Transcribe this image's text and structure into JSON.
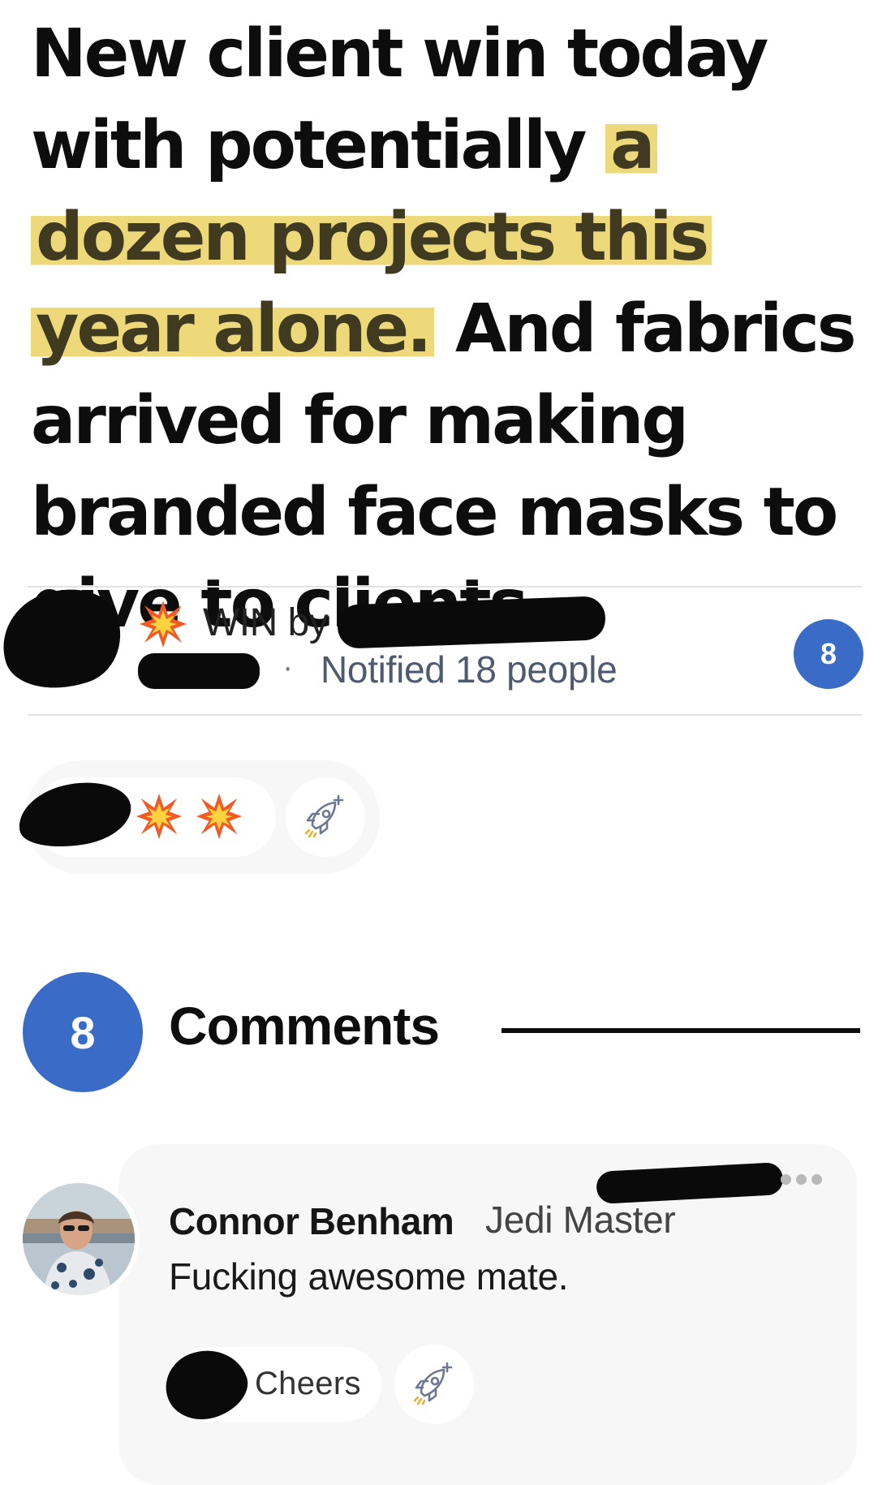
{
  "post": {
    "headline_part1": "New client win today with potentially ",
    "headline_highlight": "a dozen projects this year alone.",
    "headline_part2": " And fabrics arrived for making branded face masks to give to clients."
  },
  "meta": {
    "category_icon": "collision-emoji-icon",
    "win_by_label": "WIN by",
    "notified_label": "Notified 18 people",
    "count": "8"
  },
  "reactions": {
    "emojis": [
      "collision-emoji-icon",
      "collision-emoji-icon"
    ],
    "add_reaction_icon": "rocket-plus-icon"
  },
  "comments_section": {
    "count": "8",
    "title": "Comments"
  },
  "comment": {
    "author_name": "Connor Benham",
    "author_title": "Jedi Master",
    "text": "Fucking awesome mate.",
    "reaction_label": "Cheers",
    "more_icon": "more-dots-icon"
  },
  "colors": {
    "accent_blue": "#3a6cc7",
    "highlight_yellow": "#e8cd55",
    "card_bg": "#f7f7f7"
  }
}
